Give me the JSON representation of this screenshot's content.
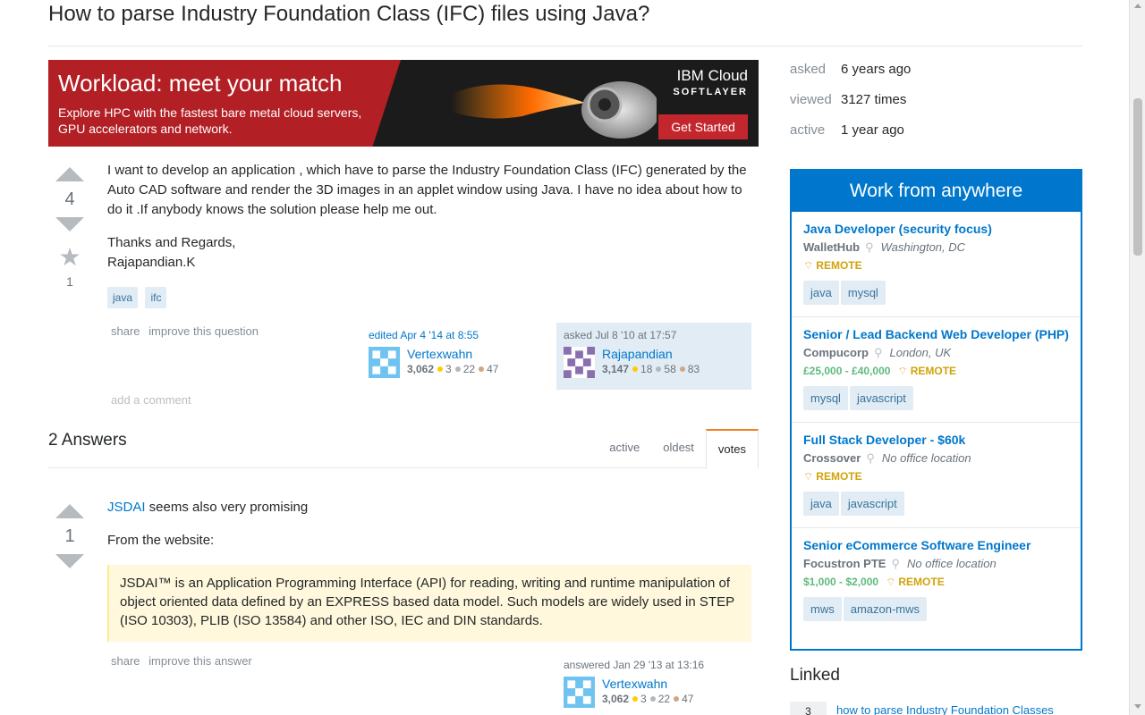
{
  "question": {
    "title": "How to parse Industry Foundation Class (IFC) files using Java?",
    "votes": "4",
    "favorites": "1",
    "body": [
      "I want to develop an application , which have to parse the Industry Foundation Class (IFC) generated by the Auto CAD software and render the 3D images in an applet window using Java. I have no idea about how to do it .If anybody knows the solution please help me out.",
      "Thanks and Regards,",
      "Rajapandian.K"
    ],
    "tags": [
      "java",
      "ifc"
    ],
    "menu": {
      "share": "share",
      "improve": "improve this question"
    },
    "editor": {
      "action": "edited Apr 4 '14 at 8:55",
      "name": "Vertexwahn",
      "rep": "3,062",
      "gold": "3",
      "silver": "22",
      "bronze": "47"
    },
    "owner": {
      "action": "asked Jul 8 '10 at 17:57",
      "name": "Rajapandian",
      "rep": "3,147",
      "gold": "18",
      "silver": "58",
      "bronze": "83"
    },
    "add_comment": "add a comment"
  },
  "banner": {
    "headline": "Workload: meet your match",
    "subtext": "Explore HPC with the fastest bare metal cloud servers, GPU accelerators and network.",
    "brand_line1": "IBM Cloud",
    "brand_line2": "SOFTLAYER",
    "cta": "Get Started"
  },
  "answers_header": {
    "count": "2 Answers",
    "tabs": [
      "active",
      "oldest",
      "votes"
    ],
    "active_tab": "votes"
  },
  "answer": {
    "votes": "1",
    "link_text": "JSDAI",
    "line1_rest": " seems also very promising",
    "line2": "From the website:",
    "quote": "JSDAI™ is an Application Programming Interface (API) for reading, writing and runtime manipulation of object oriented data defined by an EXPRESS based data model. Such models are widely used in STEP (ISO 10303), PLIB (ISO 13584) and other ISO, IEC and DIN standards.",
    "menu": {
      "share": "share",
      "improve": "improve this answer"
    },
    "author": {
      "action": "answered Jan 29 '13 at 13:16",
      "name": "Vertexwahn",
      "rep": "3,062",
      "gold": "3",
      "silver": "22",
      "bronze": "47"
    }
  },
  "stats": [
    {
      "label": "asked",
      "value": "6 years ago"
    },
    {
      "label": "viewed",
      "value": "3127 times"
    },
    {
      "label": "active",
      "value": "1 year ago"
    }
  ],
  "jobs": {
    "header": "Work from anywhere",
    "items": [
      {
        "title": "Java Developer (security focus)",
        "company": "WalletHub",
        "location": "Washington, DC",
        "salary": "",
        "remote": "REMOTE",
        "tags": [
          "java",
          "mysql"
        ]
      },
      {
        "title": "Senior / Lead Backend Web Developer (PHP)",
        "company": "Compucorp",
        "location": "London, UK",
        "salary": "£25,000 - £40,000",
        "remote": "REMOTE",
        "tags": [
          "mysql",
          "javascript"
        ]
      },
      {
        "title": "Full Stack Developer - $60k",
        "company": "Crossover",
        "location": "No office location",
        "salary": "",
        "remote": "REMOTE",
        "tags": [
          "java",
          "javascript"
        ]
      },
      {
        "title": "Senior eCommerce Software Engineer",
        "company": "Focustron PTE",
        "location": "No office location",
        "salary": "$1,000 - $2,000",
        "remote": "REMOTE",
        "tags": [
          "mws",
          "amazon-mws"
        ]
      }
    ]
  },
  "linked": {
    "header": "Linked",
    "items": [
      {
        "count": "3",
        "text": "how to parse Industry Foundation Classes"
      }
    ]
  },
  "colors": {
    "link": "#0077cc",
    "tag_bg": "#e1ecf4",
    "tag_fg": "#39739d",
    "accent": "#f48024",
    "quote_bg": "#fff8dc"
  }
}
